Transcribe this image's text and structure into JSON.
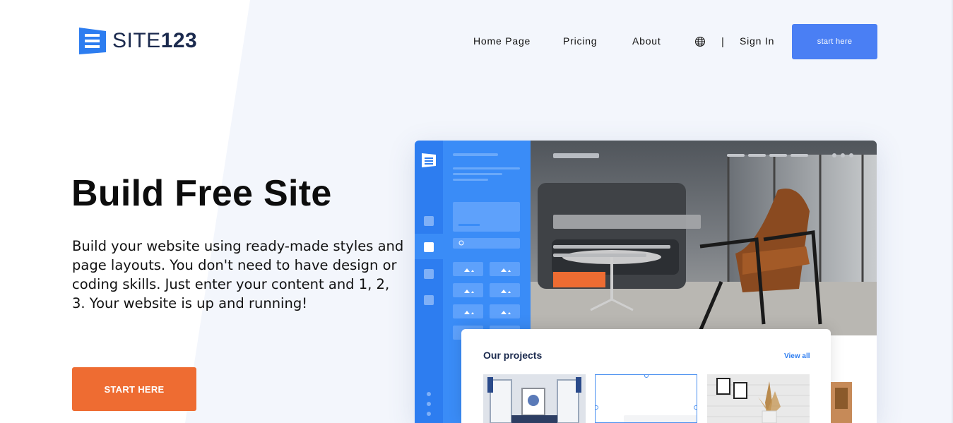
{
  "brand": {
    "name_light": "SITE",
    "name_bold": "123",
    "icon": "site123-logo-icon",
    "color": "#2d7df0"
  },
  "nav": {
    "items": [
      "Home Page",
      "Pricing",
      "About"
    ],
    "language_icon": "globe-icon",
    "separator": "|",
    "sign_in": "Sign In",
    "cta": "start here",
    "cta_color": "#4a7ff4"
  },
  "hero": {
    "title": "Build Free Site",
    "description": "Build your website using ready-made styles and page layouts. You don't need to have design or coding skills. Just enter your content and 1, 2, 3. Your website is up and running!",
    "cta": "START HERE",
    "cta_color": "#ee6c32"
  },
  "preview": {
    "projects_title": "Our projects",
    "view_all": "View all"
  }
}
